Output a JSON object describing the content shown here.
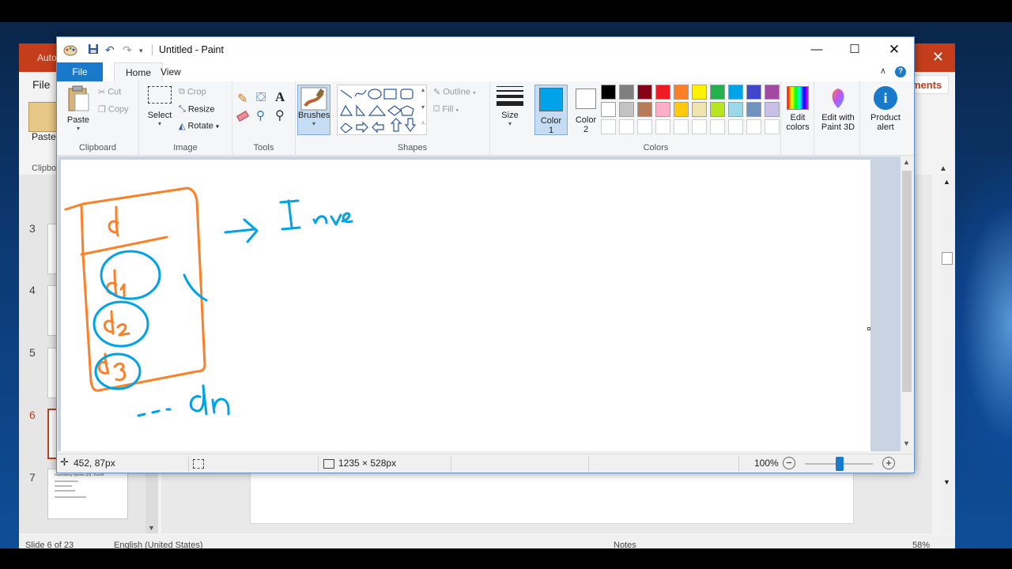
{
  "powerpoint": {
    "title_partial": "Auto",
    "file_tab": "File",
    "paste_label": "Paste",
    "clipboard_label": "Clipbo",
    "comments_partial": "ments",
    "slide_numbers": [
      "3",
      "4",
      "5",
      "6",
      "7"
    ],
    "active_slide": "6",
    "slide7_title": "Dependency Injection (DI) - ExcelR",
    "status_slide": "Slide 6 of 23",
    "status_language": "English (United States)",
    "status_notes": "Notes",
    "status_zoom": "58%"
  },
  "paint": {
    "window_title": "Untitled - Paint",
    "tabs": {
      "file": "File",
      "home": "Home",
      "view": "View"
    },
    "clipboard": {
      "paste": "Paste",
      "cut": "Cut",
      "copy": "Copy",
      "group_label": "Clipboard"
    },
    "image": {
      "select": "Select",
      "crop": "Crop",
      "resize": "Resize",
      "rotate": "Rotate",
      "group_label": "Image"
    },
    "tools": {
      "group_label": "Tools",
      "text_tool": "A"
    },
    "brushes": {
      "label": "Brushes"
    },
    "shapes": {
      "outline": "Outline",
      "fill": "Fill",
      "group_label": "Shapes"
    },
    "size": {
      "label": "Size"
    },
    "color1": {
      "label": "Color",
      "num": "1",
      "value": "#00a2e8"
    },
    "color2": {
      "label": "Color",
      "num": "2",
      "value": "#ffffff"
    },
    "colors_group_label": "Colors",
    "palette_row1": [
      "#000000",
      "#7f7f7f",
      "#880015",
      "#ed1c24",
      "#ff7f27",
      "#fff200",
      "#22b14c",
      "#00a2e8",
      "#3f48cc",
      "#a349a4"
    ],
    "palette_row2": [
      "#ffffff",
      "#c3c3c3",
      "#b97a57",
      "#ffaec9",
      "#ffc90e",
      "#efe4b0",
      "#b5e61d",
      "#99d9ea",
      "#7092be",
      "#c8bfe7"
    ],
    "edit_colors": {
      "line1": "Edit",
      "line2": "colors"
    },
    "paint3d": {
      "line1": "Edit with",
      "line2": "Paint 3D"
    },
    "product_alert": {
      "line1": "Product",
      "line2": "alert"
    },
    "status": {
      "cursor_pos": "452, 87px",
      "canvas_size": "1235 × 528px",
      "zoom": "100%"
    },
    "drawing": {
      "box_label": "d",
      "items": [
        "d1",
        "d2",
        "d3"
      ],
      "trailing": "dn",
      "arrow_text": "Inve",
      "orange": "#ff7f27",
      "blue": "#00a2e8"
    }
  }
}
